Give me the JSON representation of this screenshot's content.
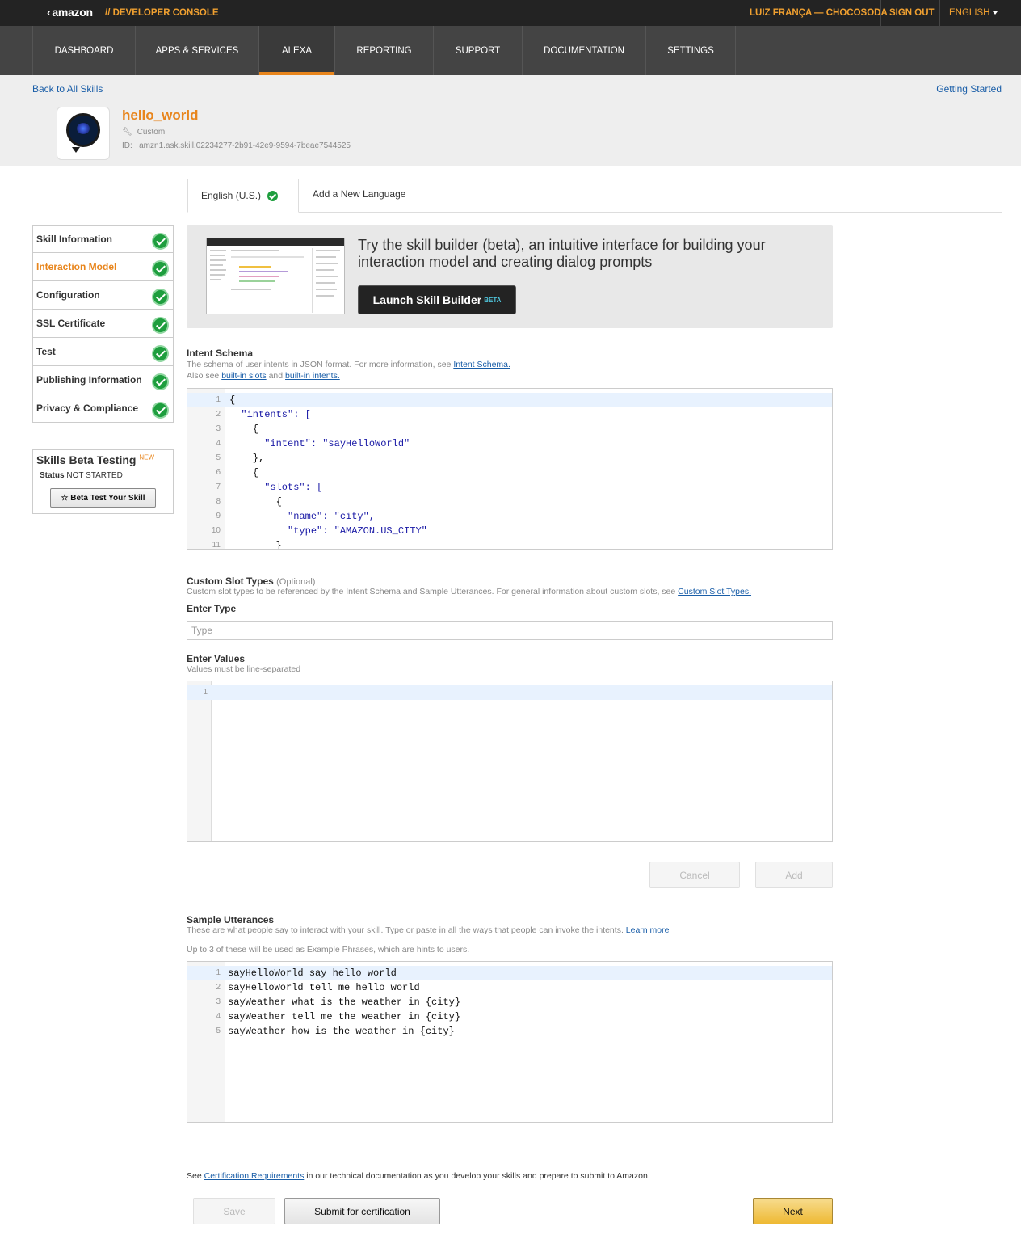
{
  "topbar": {
    "logo": "amazon",
    "console_label": "// DEVELOPER CONSOLE",
    "user": "LUIZ FRANÇA — CHOCOSODA",
    "signout": "SIGN OUT",
    "language": "ENGLISH"
  },
  "nav": {
    "items": [
      "DASHBOARD",
      "APPS & SERVICES",
      "ALEXA",
      "REPORTING",
      "SUPPORT",
      "DOCUMENTATION",
      "SETTINGS"
    ],
    "active": "ALEXA"
  },
  "header": {
    "back": "Back to All Skills",
    "getting_started": "Getting Started",
    "skill_name": "hello_world",
    "skill_type": "Custom",
    "skill_id_label": "ID:",
    "skill_id": "amzn1.ask.skill.02234277-2b91-42e9-9594-7beae7544525"
  },
  "tabs": {
    "current": "English (U.S.)",
    "add": "Add a New Language"
  },
  "sidebar": {
    "items": [
      {
        "label": "Skill Information",
        "done": true
      },
      {
        "label": "Interaction Model",
        "done": true,
        "active": true
      },
      {
        "label": "Configuration",
        "done": true
      },
      {
        "label": "SSL Certificate",
        "done": true
      },
      {
        "label": "Test",
        "done": true
      },
      {
        "label": "Publishing Information",
        "done": true
      },
      {
        "label": "Privacy & Compliance",
        "done": true
      }
    ]
  },
  "beta_testing": {
    "title": "Skills Beta Testing",
    "badge": "NEW",
    "status_label": "Status",
    "status_value": "NOT STARTED",
    "button": "☆ Beta Test Your Skill"
  },
  "promo": {
    "text": "Try the skill builder (beta), an intuitive interface for building your interaction model and creating dialog prompts",
    "button": "Launch Skill Builder",
    "button_badge": "BETA"
  },
  "intent_schema": {
    "title": "Intent Schema",
    "desc": "The schema of user intents in JSON format. For more information, see",
    "desc_link": "Intent Schema.",
    "also": "Also see",
    "slots_link": "built-in slots",
    "and": "and",
    "intents_link": "built-in intents.",
    "lines": [
      "{",
      "  \"intents\": [",
      "    {",
      "      \"intent\": \"sayHelloWorld\"",
      "    },",
      "    {",
      "      \"slots\": [",
      "        {",
      "          \"name\": \"city\",",
      "          \"type\": \"AMAZON.US_CITY\"",
      "        }"
    ]
  },
  "custom_slots": {
    "title": "Custom Slot Types",
    "optional": "(Optional)",
    "desc": "Custom slot types to be referenced by the Intent Schema and Sample Utterances. For general information about custom slots, see",
    "desc_link": "Custom Slot Types.",
    "enter_type": "Enter Type",
    "type_placeholder": "Type",
    "enter_values": "Enter Values",
    "values_desc": "Values must be line-separated",
    "cancel": "Cancel",
    "add": "Add"
  },
  "utterances": {
    "title": "Sample Utterances",
    "desc": "These are what people say to interact with your skill. Type or paste in all the ways that people can invoke the intents.",
    "learn_more": "Learn more",
    "note": "Up to 3 of these will be used as Example Phrases, which are hints to users.",
    "lines": [
      "sayHelloWorld say hello world",
      "sayHelloWorld tell me hello world",
      "sayWeather what is the weather in {city}",
      "sayWeather tell me the weather in {city}",
      "sayWeather how is the weather in {city}"
    ]
  },
  "footer": {
    "see": "See",
    "cert_link": "Certification Requirements",
    "cert_rest": "in our technical documentation as you develop your skills and prepare to submit to Amazon.",
    "save": "Save",
    "submit": "Submit for certification",
    "next": "Next"
  },
  "colors": {
    "accent_orange": "#e8851c",
    "success_green": "#1e9e3e",
    "link_blue": "#1a5ea8",
    "next_yellow": "#eeb933"
  }
}
